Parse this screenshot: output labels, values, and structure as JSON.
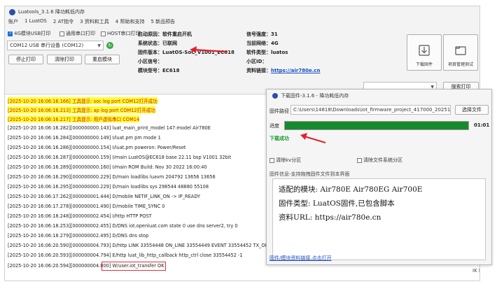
{
  "main_window": {
    "title": "Luatools_3.1.6 降功耗低内存",
    "menu": [
      "账户",
      "1 LuatOS",
      "2 AT指令",
      "3 资料和工具",
      "4 帮助和支持",
      "5 新品预告"
    ]
  },
  "top_panel": {
    "usb_checkbox": "4G模块USB打印",
    "uart_checkbox": "通用串口打印",
    "host_checkbox": "HOST串口打印",
    "port_select": "COM12 USB 串行设备 (COM12)",
    "stop_button": "停止打印",
    "clear_button": "清除打印",
    "restart_button": "重启模块",
    "info_left": [
      {
        "label": "启动原因：",
        "value": "软件重启开机"
      },
      {
        "label": "系统状态：",
        "value": "已联网"
      },
      {
        "label": "固件版本：",
        "value": "LuatOS-SoC_V1001_EC618"
      },
      {
        "label": "小区信号：",
        "value": ""
      },
      {
        "label": "模块型号：",
        "value": "EC618"
      }
    ],
    "info_right": [
      {
        "label": "信号强度：",
        "value": "31"
      },
      {
        "label": "当前网络：",
        "value": "4G"
      },
      {
        "label": "软件类型：",
        "value": "luatos"
      },
      {
        "label": "小区ID：",
        "value": ""
      },
      {
        "label": "资料链接：",
        "value": "https://air780e.cn"
      }
    ],
    "download_button": "下载固件",
    "recovery_button": "项目管理测试",
    "search_button": "搜索打印"
  },
  "log_lines": [
    "[2025-10-20 16:06:16.166] 工具提示: soc log port COM12打开成功",
    "[2025-10-20 16:06:16.213] 工具提示: ap log port COM12打开成功",
    "[2025-10-20 16:06:16.217] 工具提示: 用户虚拟串口 COM14",
    "[2025-10-20 16:06:16.282][000000000.143] luat_main_print_model 147:model Air780E",
    "[2025-10-20 16:06:16.284][000000000.149] I/luat.pm pm mode 1",
    "[2025-10-20 16:06:16.286][000000000.154] I/luat.pm poweron: Power/Reset",
    "[2025-10-20 16:06:16.287][000000000.159] I/main LuatOS@EC618 base 22.11 bsp V1001 32bit",
    "[2025-10-20 16:06:16.289][000000000.160] I/main ROM Build: Nov 30 2022 16:00:40",
    "[2025-10-20 16:06:16.290][000000000.229] D/main loadlibs luavm 204792 13656 13656",
    "[2025-10-20 16:06:16.295][000000000.229] D/main loadlibs sys    298544 48880 55108",
    "[2025-10-20 16:06:17.262][000000001.444] D/mobile NETIF_LINK_ON -> IP_READY",
    "[2025-10-20 16:06:17.278][000000001.490] D/mobile TIME_SYNC 0",
    "[2025-10-20 16:06:18.248][000000002.454] I/http HTTP POST",
    "[2025-10-20 16:06:18.253][000000002.455] D/DNS iot.openluat.com state 0 use dns server2, try 0",
    "[2025-10-20 16:06:18.279][000000002.495] D/DNS dns stop",
    "[2025-10-20 16:06:20.590][000000004.793] D/http LINK 33554448 ON_LINE 33554449 EVENT 33554452 TX_OK 33554",
    "[2025-10-20 16:06:20.593][000000004.794] E/http luat_lib_http_callback http_ctrl close 33554452 -1",
    "[2025-10-20 16:06:20.594][000000004.800] W/user.iot_transfer      OK"
  ],
  "download_window": {
    "title": "下载固件-3.1.6 - 降功耗低内存",
    "path_label": "固件路径",
    "path_value": "C:\\Users\\14818\\Downloads\\iot_firmware_project_417000_2025102015428",
    "choose_button": "选择文件",
    "progress_label": "进度",
    "progress": 1.0,
    "time": "01:01",
    "status": "下载成功",
    "clear_kv": "清除kv分区",
    "clear_fs": "清除文件系统分区",
    "info_header": "固件信息-支持拖拽固件文件到本界面",
    "info_lines": [
      "适配的模块: Air780E Air780EG Air700E",
      "固件类型: LuatOS固件,已包含脚本",
      "资料URL: https://air780e.cn"
    ],
    "bottom_link": "固件/模块资料链接,点击打开"
  },
  "side_text": "IK K"
}
